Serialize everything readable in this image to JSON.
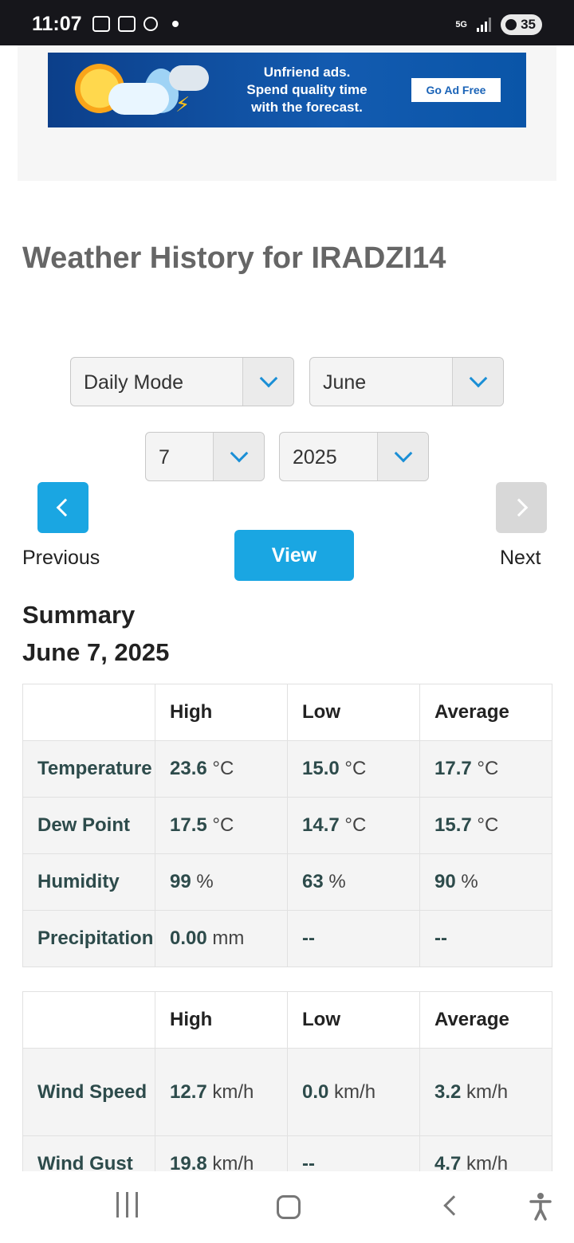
{
  "status_bar": {
    "time": "11:07",
    "network": "5G",
    "battery": "35"
  },
  "ad": {
    "line1": "Unfriend ads.",
    "line2": "Spend quality time",
    "line3": "with the forecast.",
    "button": "Go Ad Free"
  },
  "page": {
    "title": "Weather History for IRADZI14"
  },
  "controls": {
    "mode": "Daily Mode",
    "month": "June",
    "day": "7",
    "year": "2025",
    "previous_label": "Previous",
    "next_label": "Next",
    "view_label": "View"
  },
  "summary": {
    "title": "Summary",
    "date": "June 7, 2025"
  },
  "table1": {
    "headers": [
      "",
      "High",
      "Low",
      "Average"
    ],
    "rows": [
      {
        "label": "Temperature",
        "high": "23.6",
        "high_unit": "°C",
        "low": "15.0",
        "low_unit": "°C",
        "avg": "17.7",
        "avg_unit": "°C"
      },
      {
        "label": "Dew Point",
        "high": "17.5",
        "high_unit": "°C",
        "low": "14.7",
        "low_unit": "°C",
        "avg": "15.7",
        "avg_unit": "°C"
      },
      {
        "label": "Humidity",
        "high": "99",
        "high_unit": "%",
        "low": "63",
        "low_unit": "%",
        "avg": "90",
        "avg_unit": "%"
      },
      {
        "label": "Precipitation",
        "high": "0.00",
        "high_unit": "mm",
        "low": "--",
        "low_unit": "",
        "avg": "--",
        "avg_unit": ""
      }
    ]
  },
  "table2": {
    "headers": [
      "",
      "High",
      "Low",
      "Average"
    ],
    "rows": [
      {
        "label": "Wind Speed",
        "high": "12.7",
        "high_unit": "km/h",
        "low": "0.0",
        "low_unit": "km/h",
        "avg": "3.2",
        "avg_unit": "km/h"
      },
      {
        "label": "Wind Gust",
        "high": "19.8",
        "high_unit": "km/h",
        "low": "--",
        "low_unit": "",
        "avg": "4.7",
        "avg_unit": "km/h"
      }
    ]
  },
  "colors": {
    "accent": "#1aa6e2",
    "row_label": "#2d4b4b",
    "title_gray": "#666666"
  }
}
